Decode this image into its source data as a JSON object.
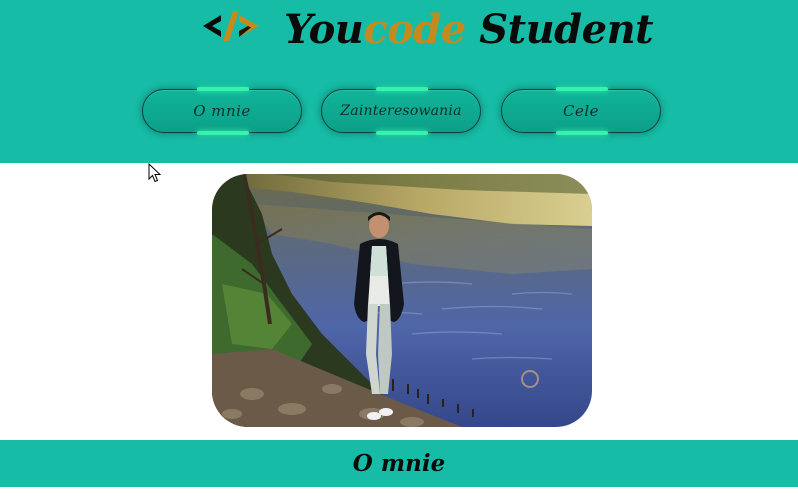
{
  "header": {
    "title_part1": "You",
    "title_accent": "code",
    "title_part2": " Student",
    "logo_icon": "code-brackets-icon"
  },
  "nav": {
    "items": [
      {
        "label": "O mnie"
      },
      {
        "label": "Zainteresowania"
      },
      {
        "label": "Cele"
      }
    ]
  },
  "main": {
    "photo_icon": "person-by-river-photo"
  },
  "section": {
    "title": "O mnie"
  },
  "colors": {
    "header_bg": "#16bca6",
    "accent": "#c58a1d",
    "button_glow": "#35f3ad",
    "text": "#0a0a0a"
  }
}
